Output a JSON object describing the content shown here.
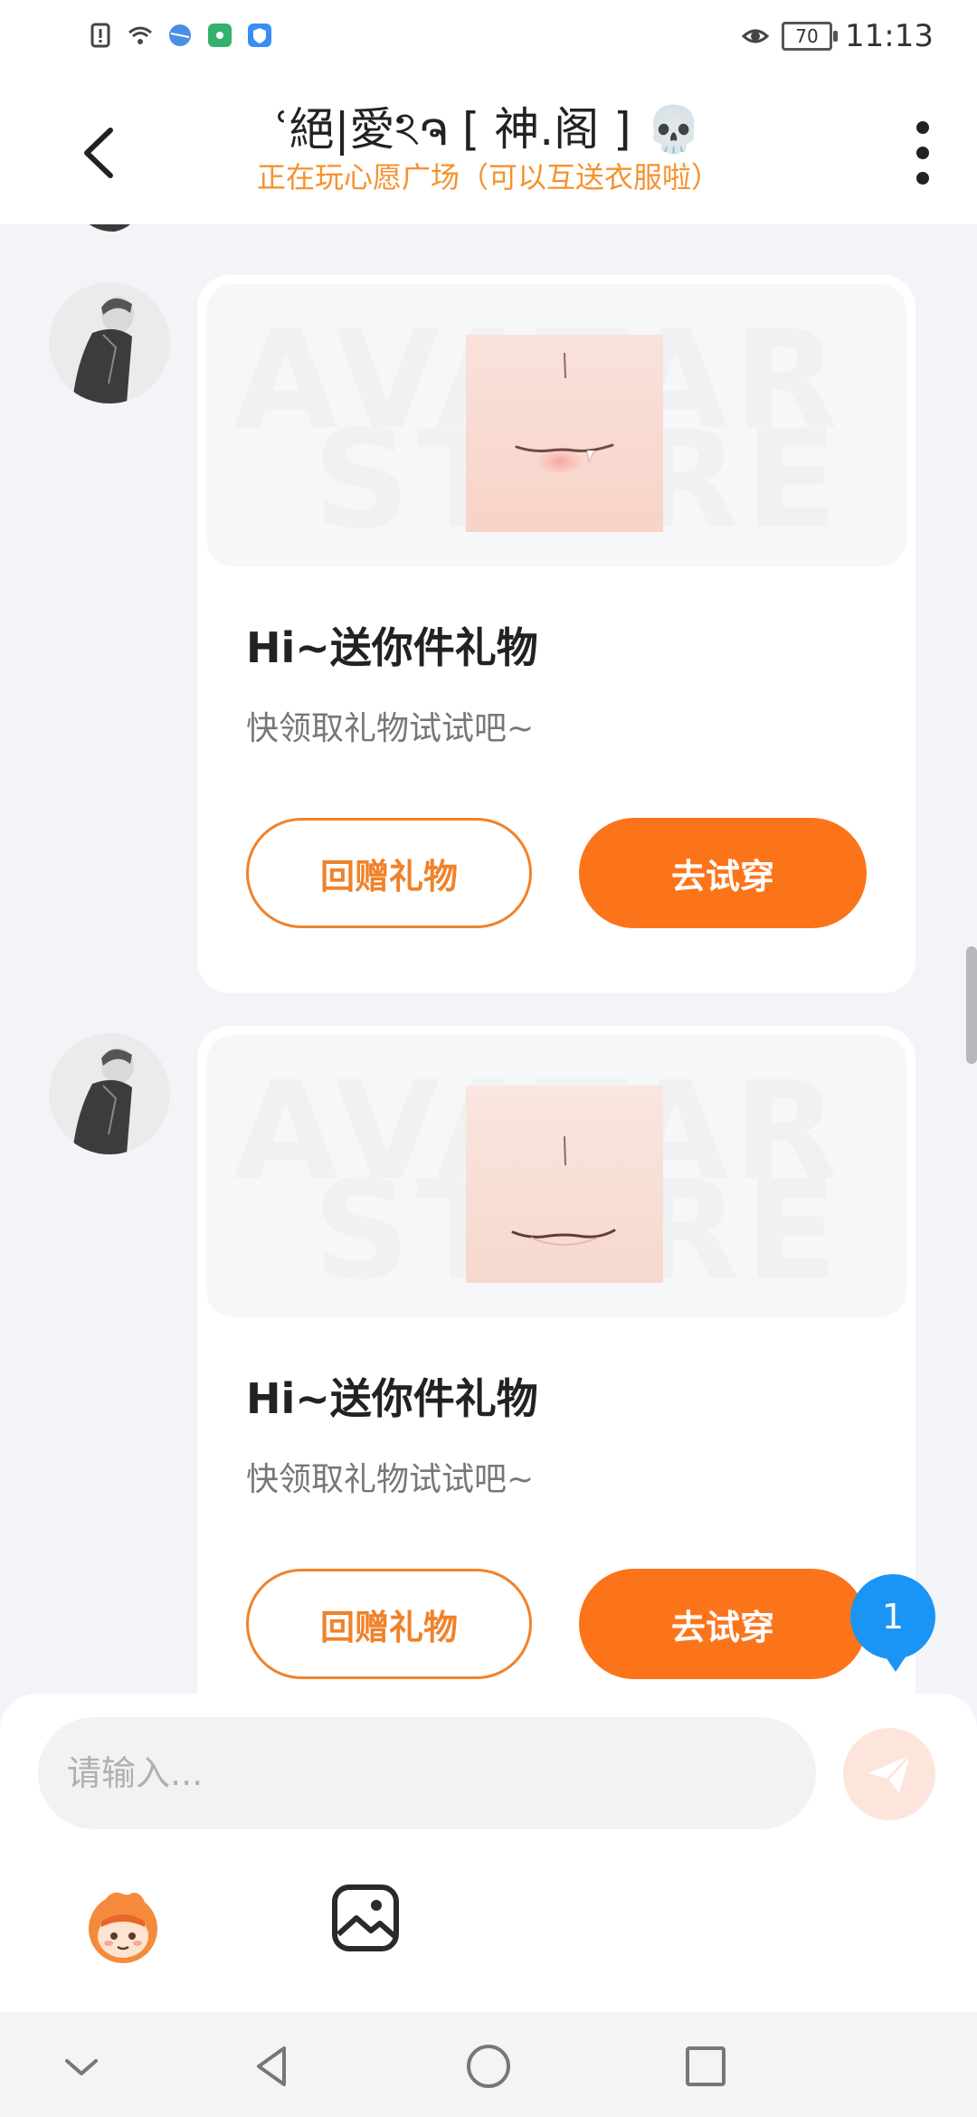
{
  "status_bar": {
    "time": "11:13",
    "battery": "70",
    "left_icons": [
      "alert-icon",
      "wifi-icon",
      "browser-icon",
      "hotspot-icon",
      "shield-icon"
    ],
    "right_icons": [
      "eye-icon",
      "battery-icon"
    ]
  },
  "header": {
    "title": "ʿ絕|愛ঽຈ [ 神.阁 ] 💀",
    "subtitle": "正在玩心愿广场（可以互送衣服啦）"
  },
  "messages": [
    {
      "watermark_line1": "AVATAR",
      "watermark_line2": "STORE",
      "title": "Hi~送你件礼物",
      "desc": "快领取礼物试试吧~",
      "btn_return": "回赠礼物",
      "btn_try": "去试穿"
    },
    {
      "watermark_line1": "AVATAR",
      "watermark_line2": "STORE",
      "title": "Hi~送你件礼物",
      "desc": "快领取礼物试试吧~",
      "btn_return": "回赠礼物",
      "btn_try": "去试穿"
    }
  ],
  "unread_count": "1",
  "input": {
    "placeholder": "请输入..."
  },
  "toolbar": {
    "icons": [
      "sticker-icon",
      "image-icon",
      "send-icon"
    ]
  },
  "nav": {
    "icons": [
      "chevron-down-icon",
      "back-triangle-icon",
      "home-circle-icon",
      "recent-square-icon"
    ]
  },
  "colors": {
    "accent": "#fc741a",
    "accent_outline": "#f0822a",
    "subtitle": "#f6922d",
    "badge": "#1a94f5",
    "background": "#f2f4f7"
  }
}
